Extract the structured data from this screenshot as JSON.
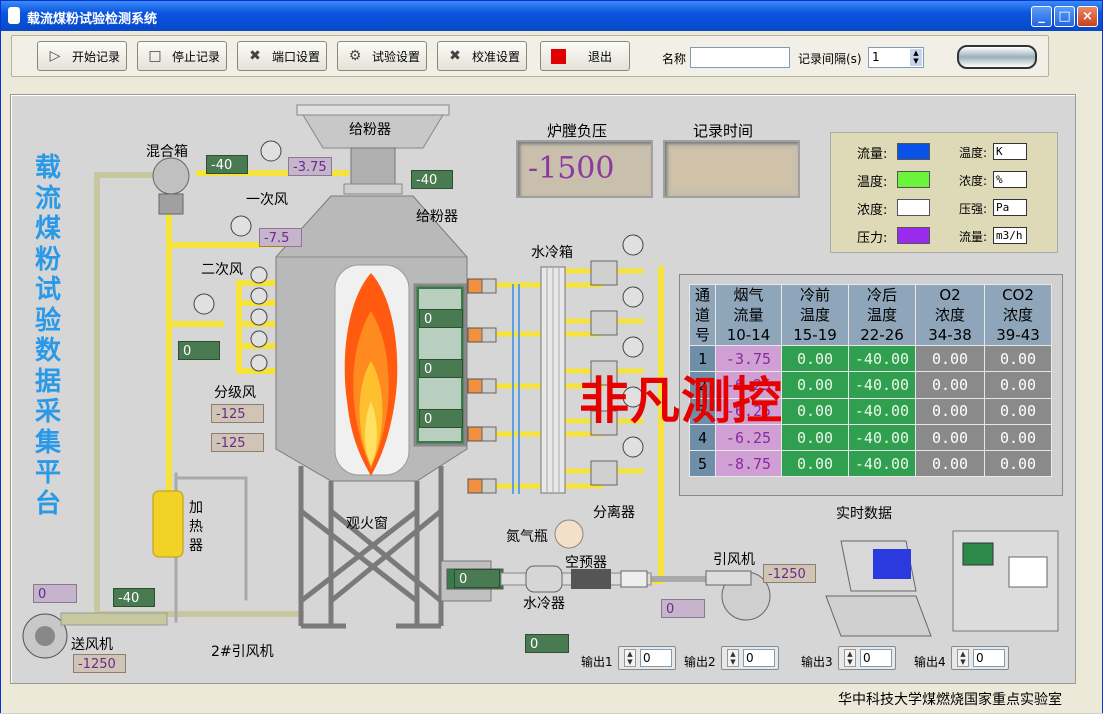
{
  "window": {
    "title": "载流煤粉试验检测系统"
  },
  "toolbar": {
    "start_label": "开始记录",
    "stop_label": "停止记录",
    "port_label": "端口设置",
    "test_label": "试验设置",
    "calib_label": "校准设置",
    "exit_label": "退出",
    "name_label": "名称",
    "name_value": "",
    "interval_label": "记录间隔(s)",
    "interval_value": "1"
  },
  "side_title": [
    "载",
    "流",
    "煤",
    "粉",
    "试",
    "验",
    "数",
    "据",
    "采",
    "集",
    "平",
    "台"
  ],
  "labels": {
    "mix_box": "混合箱",
    "primary_air": "一次风",
    "secondary_air": "二次风",
    "staged_air": "分级风",
    "feeder_top": "给粉器",
    "feeder_side": "给粉器",
    "heater": [
      "加",
      "热",
      "器"
    ],
    "fan_blow": "送风机",
    "fan2": "2#引风机",
    "observe_window": "观火窗",
    "water_box": "水冷箱",
    "nitrogen": "氮气瓶",
    "separator": "分离器",
    "preheater": "空预器",
    "water_cooler": "水冷器",
    "induced_fan": "引风机",
    "realtime": "实时数据",
    "furnace_pressure": "炉膛负压",
    "record_time": "记录时间"
  },
  "readings": {
    "mix_flow": "-40",
    "primary_val": "-3.75",
    "secondary_val": "-7.5",
    "feeder_val": "-40",
    "stage_left": "0",
    "stage_a": "-125",
    "stage_b": "-125",
    "furnace_pressure": "-1500",
    "record_time": "",
    "win1": "0",
    "win2": "0",
    "win3": "0",
    "blower_purple": "0",
    "blower_green": "-40",
    "blower_tan": "-1250",
    "preheater_green": "0",
    "bottom_green": "0",
    "ifan_tan": "-1250",
    "ifan_purple": "0"
  },
  "legend": {
    "items": [
      {
        "name": "流量:",
        "color": "#0a52e6",
        "unit_label": "温度:",
        "unit": "K"
      },
      {
        "name": "温度:",
        "color": "#6af53a",
        "unit_label": "浓度:",
        "unit": "%"
      },
      {
        "name": "浓度:",
        "color": "#ffffff",
        "unit_label": "压强:",
        "unit": "Pa"
      },
      {
        "name": "压力:",
        "color": "#9a2aee",
        "unit_label": "流量:",
        "unit": "m3/h"
      }
    ]
  },
  "table": {
    "headers": [
      [
        "通",
        "道",
        "号"
      ],
      [
        "烟气",
        "流量",
        "10-14"
      ],
      [
        "冷前",
        "温度",
        "15-19"
      ],
      [
        "冷后",
        "温度",
        "22-26"
      ],
      [
        "O2",
        "浓度",
        "34-38"
      ],
      [
        "CO2",
        "浓度",
        "39-43"
      ]
    ],
    "rows": [
      [
        "1",
        "-3.75",
        "0.00",
        "-40.00",
        "0.00",
        "0.00"
      ],
      [
        "2",
        "-6.25",
        "0.00",
        "-40.00",
        "0.00",
        "0.00"
      ],
      [
        "3",
        "-6.25",
        "0.00",
        "-40.00",
        "0.00",
        "0.00"
      ],
      [
        "4",
        "-6.25",
        "0.00",
        "-40.00",
        "0.00",
        "0.00"
      ],
      [
        "5",
        "-8.75",
        "0.00",
        "-40.00",
        "0.00",
        "0.00"
      ]
    ]
  },
  "watermark": "非凡测控",
  "outputs": [
    {
      "label": "输出1",
      "value": "0"
    },
    {
      "label": "输出2",
      "value": "0"
    },
    {
      "label": "输出3",
      "value": "0"
    },
    {
      "label": "输出4",
      "value": "0"
    }
  ],
  "status": {
    "org": "华中科技大学煤燃烧国家重点实验室"
  },
  "colors": {
    "pipe_yellow": "#f5e23a",
    "pipe_gray": "#c8c8a0",
    "furnace": "#a9a9a9",
    "flame": "#ff7a18"
  }
}
